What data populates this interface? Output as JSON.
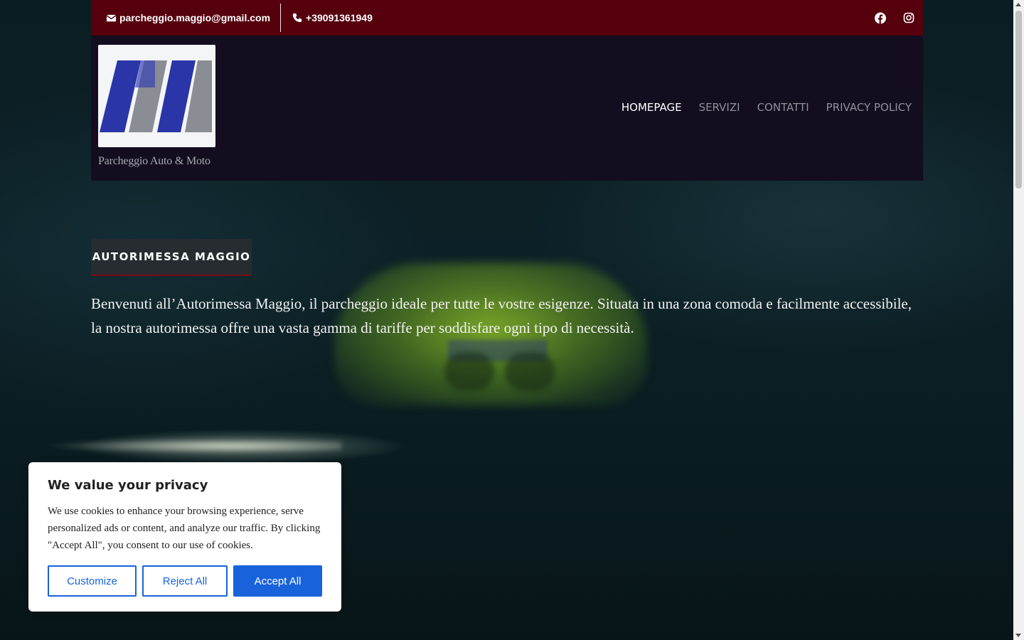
{
  "topbar": {
    "email": "parcheggio.maggio@gmail.com",
    "phone": "+39091361949",
    "email_icon": "envelope-icon",
    "phone_icon": "phone-icon",
    "social": [
      "facebook-icon",
      "instagram-icon"
    ],
    "background": "#56000d"
  },
  "header": {
    "tagline": "Parcheggio Auto & Moto",
    "nav": {
      "homepage": "HOMEPAGE",
      "servizi": "SERVIZI",
      "contatti": "CONTATTI",
      "privacy": "PRIVACY POLICY"
    },
    "active_nav": "HOMEPAGE",
    "background": "#130d1f"
  },
  "hero": {
    "badge": "AUTORIMESSA MAGGIO",
    "intro": "Benvenuti all’Autorimessa Maggio, il parcheggio ideale per tutte le vostre esigenze. Situata in una zona comoda e facilmente accessibile, la nostra autorimessa offre una vasta gamma di tariffe per soddisfare ogni tipo di necessità."
  },
  "cookie": {
    "title": "We value your privacy",
    "text": "We use cookies to enhance your browsing experience, serve personalized ads or content, and analyze our traffic. By clicking \"Accept All\", you consent to our use of cookies.",
    "customize": "Customize",
    "reject": "Reject All",
    "accept": "Accept All",
    "accent": "#1863dc"
  }
}
